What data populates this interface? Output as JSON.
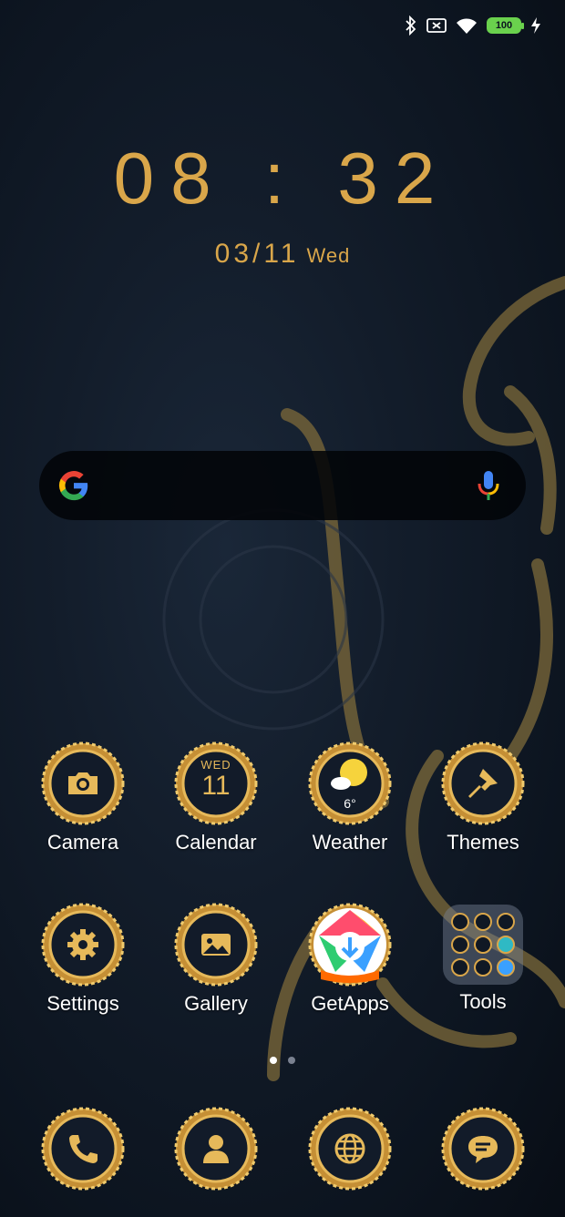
{
  "status": {
    "battery_level": "100",
    "icons": [
      "bluetooth-icon",
      "no-sim-icon",
      "wifi-icon",
      "battery-icon",
      "charging-icon"
    ]
  },
  "clock": {
    "time": "08 : 32",
    "date": "03/11",
    "weekday": "Wed"
  },
  "search": {
    "icons": [
      "google-logo-icon",
      "microphone-icon"
    ]
  },
  "apps_row1": [
    {
      "label": "Camera",
      "icon": "camera-icon"
    },
    {
      "label": "Calendar",
      "icon": "calendar-icon",
      "day": "WED",
      "date": "11"
    },
    {
      "label": "Weather",
      "icon": "weather-icon",
      "temp": "6°"
    },
    {
      "label": "Themes",
      "icon": "themes-brush-icon"
    }
  ],
  "apps_row2": [
    {
      "label": "Settings",
      "icon": "gear-icon"
    },
    {
      "label": "Gallery",
      "icon": "gallery-icon"
    },
    {
      "label": "GetApps",
      "icon": "getapps-icon"
    },
    {
      "label": "Tools",
      "icon": "folder-icon"
    }
  ],
  "dock": [
    {
      "icon": "phone-icon"
    },
    {
      "icon": "contacts-icon"
    },
    {
      "icon": "browser-globe-icon"
    },
    {
      "icon": "messages-icon"
    }
  ],
  "pages": {
    "count": 2,
    "current": 1
  },
  "colors": {
    "accent_gold": "#d9a64a",
    "background": "#0c1420",
    "battery_green": "#6ad14d"
  }
}
